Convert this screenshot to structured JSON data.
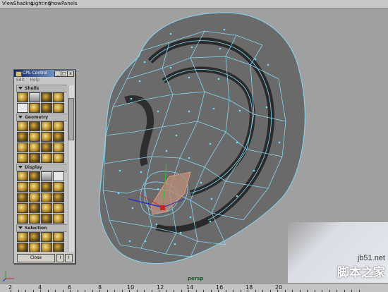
{
  "menubar": {
    "items": [
      "View",
      "Shading",
      "Lighting",
      "Show",
      "Panels"
    ]
  },
  "viewport": {
    "camera_label": "persp",
    "colors": {
      "background": "#a0a0a0",
      "mesh_face": "#6a6a6a",
      "mesh_edge": "#80d8f8",
      "vertex": "#6be0ff",
      "selected_face": "#c8927a"
    }
  },
  "cps_panel": {
    "title": "CPS Control",
    "title_buttons": [
      "_",
      "□",
      "x"
    ],
    "menu": [
      "Edit",
      "Help"
    ],
    "sections": [
      "Shells",
      "Geometry",
      "Display",
      "Selection"
    ],
    "close_label": "Close",
    "footer_buttons": [
      "I",
      "I"
    ]
  },
  "axis": {
    "x": "x",
    "y": "y",
    "z": "z"
  },
  "timeline": {
    "ticks": [
      "2",
      "4",
      "6",
      "8",
      "10",
      "12",
      "14",
      "16",
      "18",
      "20"
    ]
  },
  "watermark": {
    "url": "jb51.net",
    "text": "脚本之家"
  }
}
